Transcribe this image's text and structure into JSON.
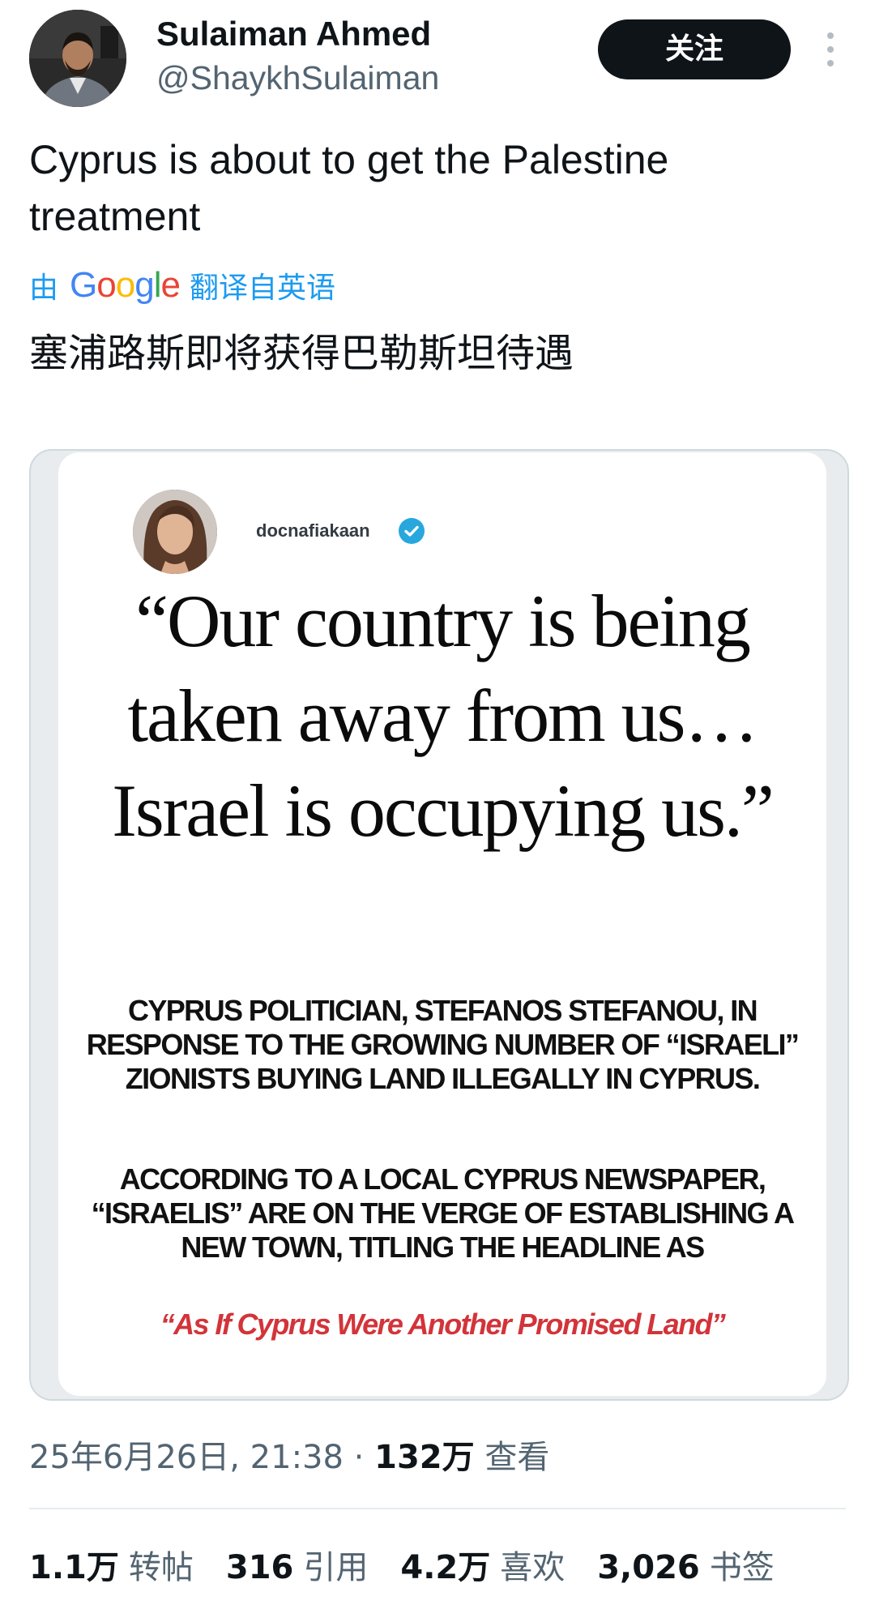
{
  "author": {
    "name": "Sulaiman Ahmed",
    "handle": "@ShaykhSulaiman"
  },
  "follow_label": "关注",
  "tweet": {
    "text": "Cyprus is about to get the Palestine treatment",
    "translation_prefix": "由",
    "translation_brand": "Google",
    "translation_suffix": "翻译自英语",
    "translated_text": "塞浦路斯即将获得巴勒斯坦待遇"
  },
  "media": {
    "username": "docnafiakaan",
    "quote": "“Our country is being taken away from us… Israel is occupying us.”",
    "caption_1": "CYPRUS POLITICIAN, STEFANOS STEFANOU, IN RESPONSE TO THE GROWING NUMBER OF “ISRAELI” ZIONISTS BUYING LAND ILLEGALLY IN CYPRUS.",
    "caption_2": "ACCORDING TO A LOCAL CYPRUS NEWSPAPER, “ISRAELIS” ARE ON THE VERGE OF ESTABLISHING A NEW TOWN, TITLING THE HEADLINE AS",
    "headline": "“As If Cyprus Were Another Promised Land”"
  },
  "meta": {
    "timestamp": "25年6月26日, 21:38",
    "separator": " · ",
    "views_count": "132万",
    "views_label": "查看"
  },
  "stats": {
    "reposts": {
      "count": "1.1万",
      "label": "转帖"
    },
    "quotes": {
      "count": "316",
      "label": "引用"
    },
    "likes": {
      "count": "4.2万",
      "label": "喜欢"
    },
    "bookmarks": {
      "count": "3,026",
      "label": "书签"
    }
  },
  "colors": {
    "text_primary": "#0f1419",
    "text_secondary": "#536471",
    "link_blue": "#1d9bf0",
    "headline_red": "#d2343a",
    "verified_blue": "#27a7dd"
  }
}
